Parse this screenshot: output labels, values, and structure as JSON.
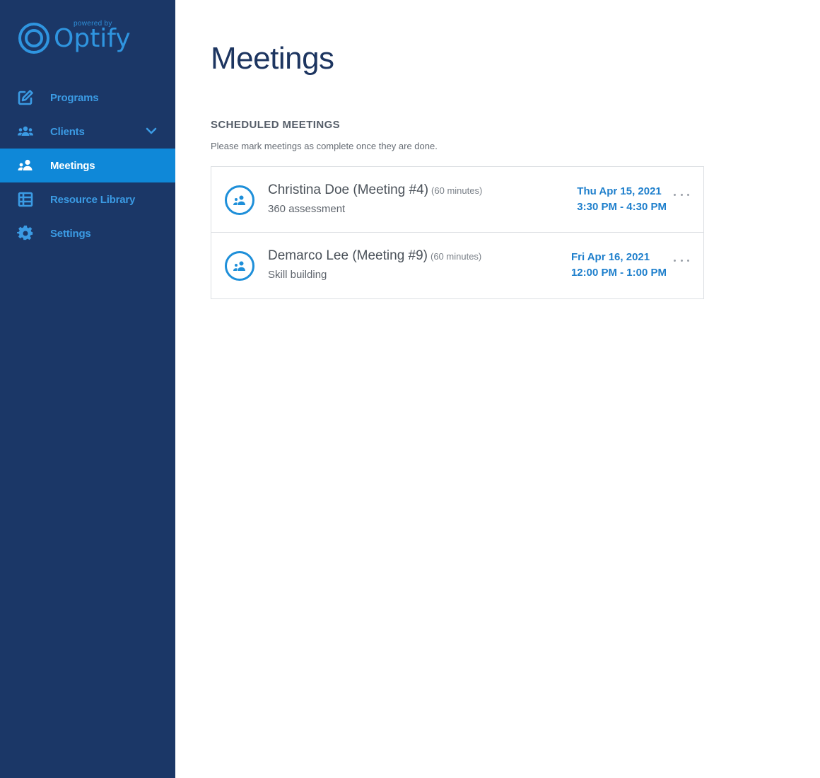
{
  "brand": {
    "powered_by": "powered by",
    "name": "Optify",
    "color": "#2f95e0"
  },
  "sidebar": {
    "background": "#1b3767",
    "active_color": "#0f88d8",
    "items": [
      {
        "label": "Programs",
        "icon": "edit-icon",
        "active": false
      },
      {
        "label": "Clients",
        "icon": "clients-icon",
        "active": false,
        "expandable": true
      },
      {
        "label": "Meetings",
        "icon": "meetings-icon",
        "active": true
      },
      {
        "label": "Resource Library",
        "icon": "list-icon",
        "active": false
      },
      {
        "label": "Settings",
        "icon": "gear-icon",
        "active": false
      }
    ]
  },
  "main": {
    "title": "Meetings",
    "section_title": "SCHEDULED MEETINGS",
    "section_subtitle": "Please mark meetings as complete once they are done.",
    "meetings": [
      {
        "name": "Christina Doe (Meeting #4)",
        "duration": "(60 minutes)",
        "topic": "360 assessment",
        "date": "Thu Apr 15, 2021",
        "time": "3:30 PM - 4:30 PM"
      },
      {
        "name": "Demarco Lee (Meeting #9)",
        "duration": "(60 minutes)",
        "topic": "Skill building",
        "date": "Fri Apr 16, 2021",
        "time": "12:00 PM - 1:00 PM"
      }
    ]
  }
}
